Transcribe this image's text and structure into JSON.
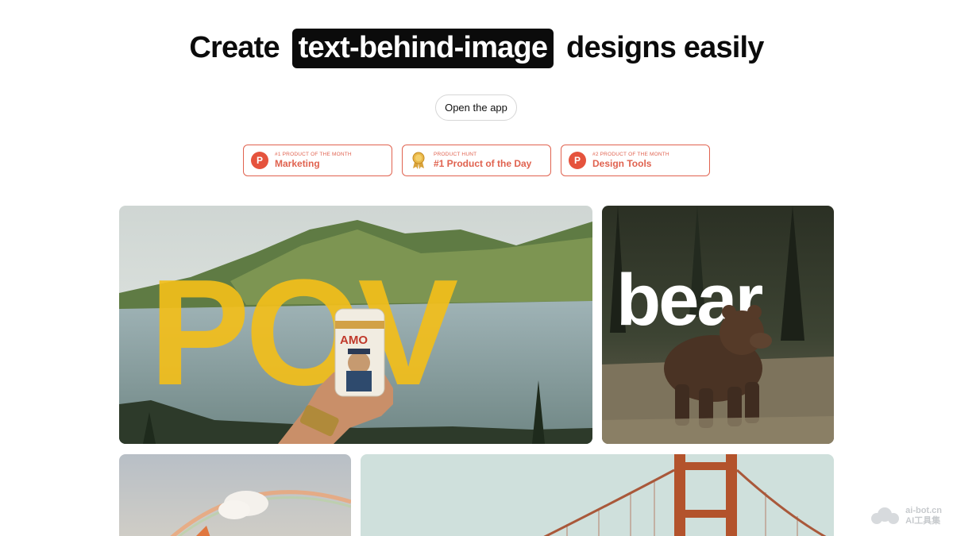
{
  "hero": {
    "title_before": "Create",
    "title_highlight": "text-behind-image",
    "title_after": "designs easily"
  },
  "cta": {
    "open_app_label": "Open the app"
  },
  "badges": [
    {
      "small": "#1 PRODUCT OF THE MONTH",
      "big": "Marketing",
      "icon": "product-hunt-icon"
    },
    {
      "small": "PRODUCT HUNT",
      "big": "#1 Product of the Day",
      "icon": "medal-icon"
    },
    {
      "small": "#2 PRODUCT OF THE MONTH",
      "big": "Design Tools",
      "icon": "product-hunt-icon"
    }
  ],
  "gallery": {
    "pov_text": "POV",
    "bear_text": "bear",
    "can_text": "AMO"
  },
  "colors": {
    "accent": "#e0624f",
    "pov_yellow": "#f2be1a",
    "dark": "#0b0b0b"
  },
  "watermark": {
    "line1": "ai-bot.cn",
    "line2": "AI工具集"
  }
}
